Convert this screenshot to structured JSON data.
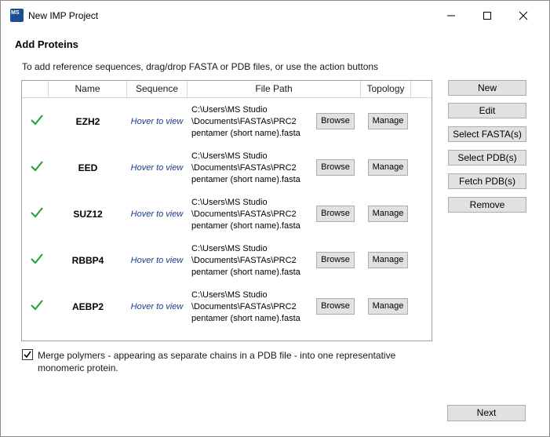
{
  "window": {
    "title": "New IMP Project",
    "icon": "ms-studio-app-icon"
  },
  "heading": "Add Proteins",
  "instructions": "To add reference sequences, drag/drop FASTA or PDB files, or use the action buttons",
  "grid": {
    "columns": [
      "",
      "Name",
      "Sequence",
      "File Path",
      "Topology"
    ],
    "rows": [
      {
        "name": "EZH2",
        "sequence": "Hover to view",
        "path_line1": "C:\\Users\\MS Studio",
        "path_line2": "\\Documents\\FASTAs\\PRC2",
        "path_line3": "pentamer (short name).fasta",
        "browse": "Browse",
        "manage": "Manage"
      },
      {
        "name": "EED",
        "sequence": "Hover to view",
        "path_line1": "C:\\Users\\MS Studio",
        "path_line2": "\\Documents\\FASTAs\\PRC2",
        "path_line3": "pentamer (short name).fasta",
        "browse": "Browse",
        "manage": "Manage"
      },
      {
        "name": "SUZ12",
        "sequence": "Hover to view",
        "path_line1": "C:\\Users\\MS Studio",
        "path_line2": "\\Documents\\FASTAs\\PRC2",
        "path_line3": "pentamer (short name).fasta",
        "browse": "Browse",
        "manage": "Manage"
      },
      {
        "name": "RBBP4",
        "sequence": "Hover to view",
        "path_line1": "C:\\Users\\MS Studio",
        "path_line2": "\\Documents\\FASTAs\\PRC2",
        "path_line3": "pentamer (short name).fasta",
        "browse": "Browse",
        "manage": "Manage"
      },
      {
        "name": "AEBP2",
        "sequence": "Hover to view",
        "path_line1": "C:\\Users\\MS Studio",
        "path_line2": "\\Documents\\FASTAs\\PRC2",
        "path_line3": "pentamer (short name).fasta",
        "browse": "Browse",
        "manage": "Manage"
      }
    ]
  },
  "actions": {
    "new": "New",
    "edit": "Edit",
    "select_fasta": "Select FASTA(s)",
    "select_pdb": "Select PDB(s)",
    "fetch_pdb": "Fetch PDB(s)",
    "remove": "Remove"
  },
  "merge": {
    "checked": true,
    "line1": "Merge polymers - appearing as separate chains in a PDB file - into one representative",
    "line2": "monomeric protein."
  },
  "footer": {
    "next": "Next"
  },
  "colors": {
    "check_green": "#1e9e3a",
    "sequence_link": "#1a3a8a",
    "button_face": "#e1e1e1"
  }
}
